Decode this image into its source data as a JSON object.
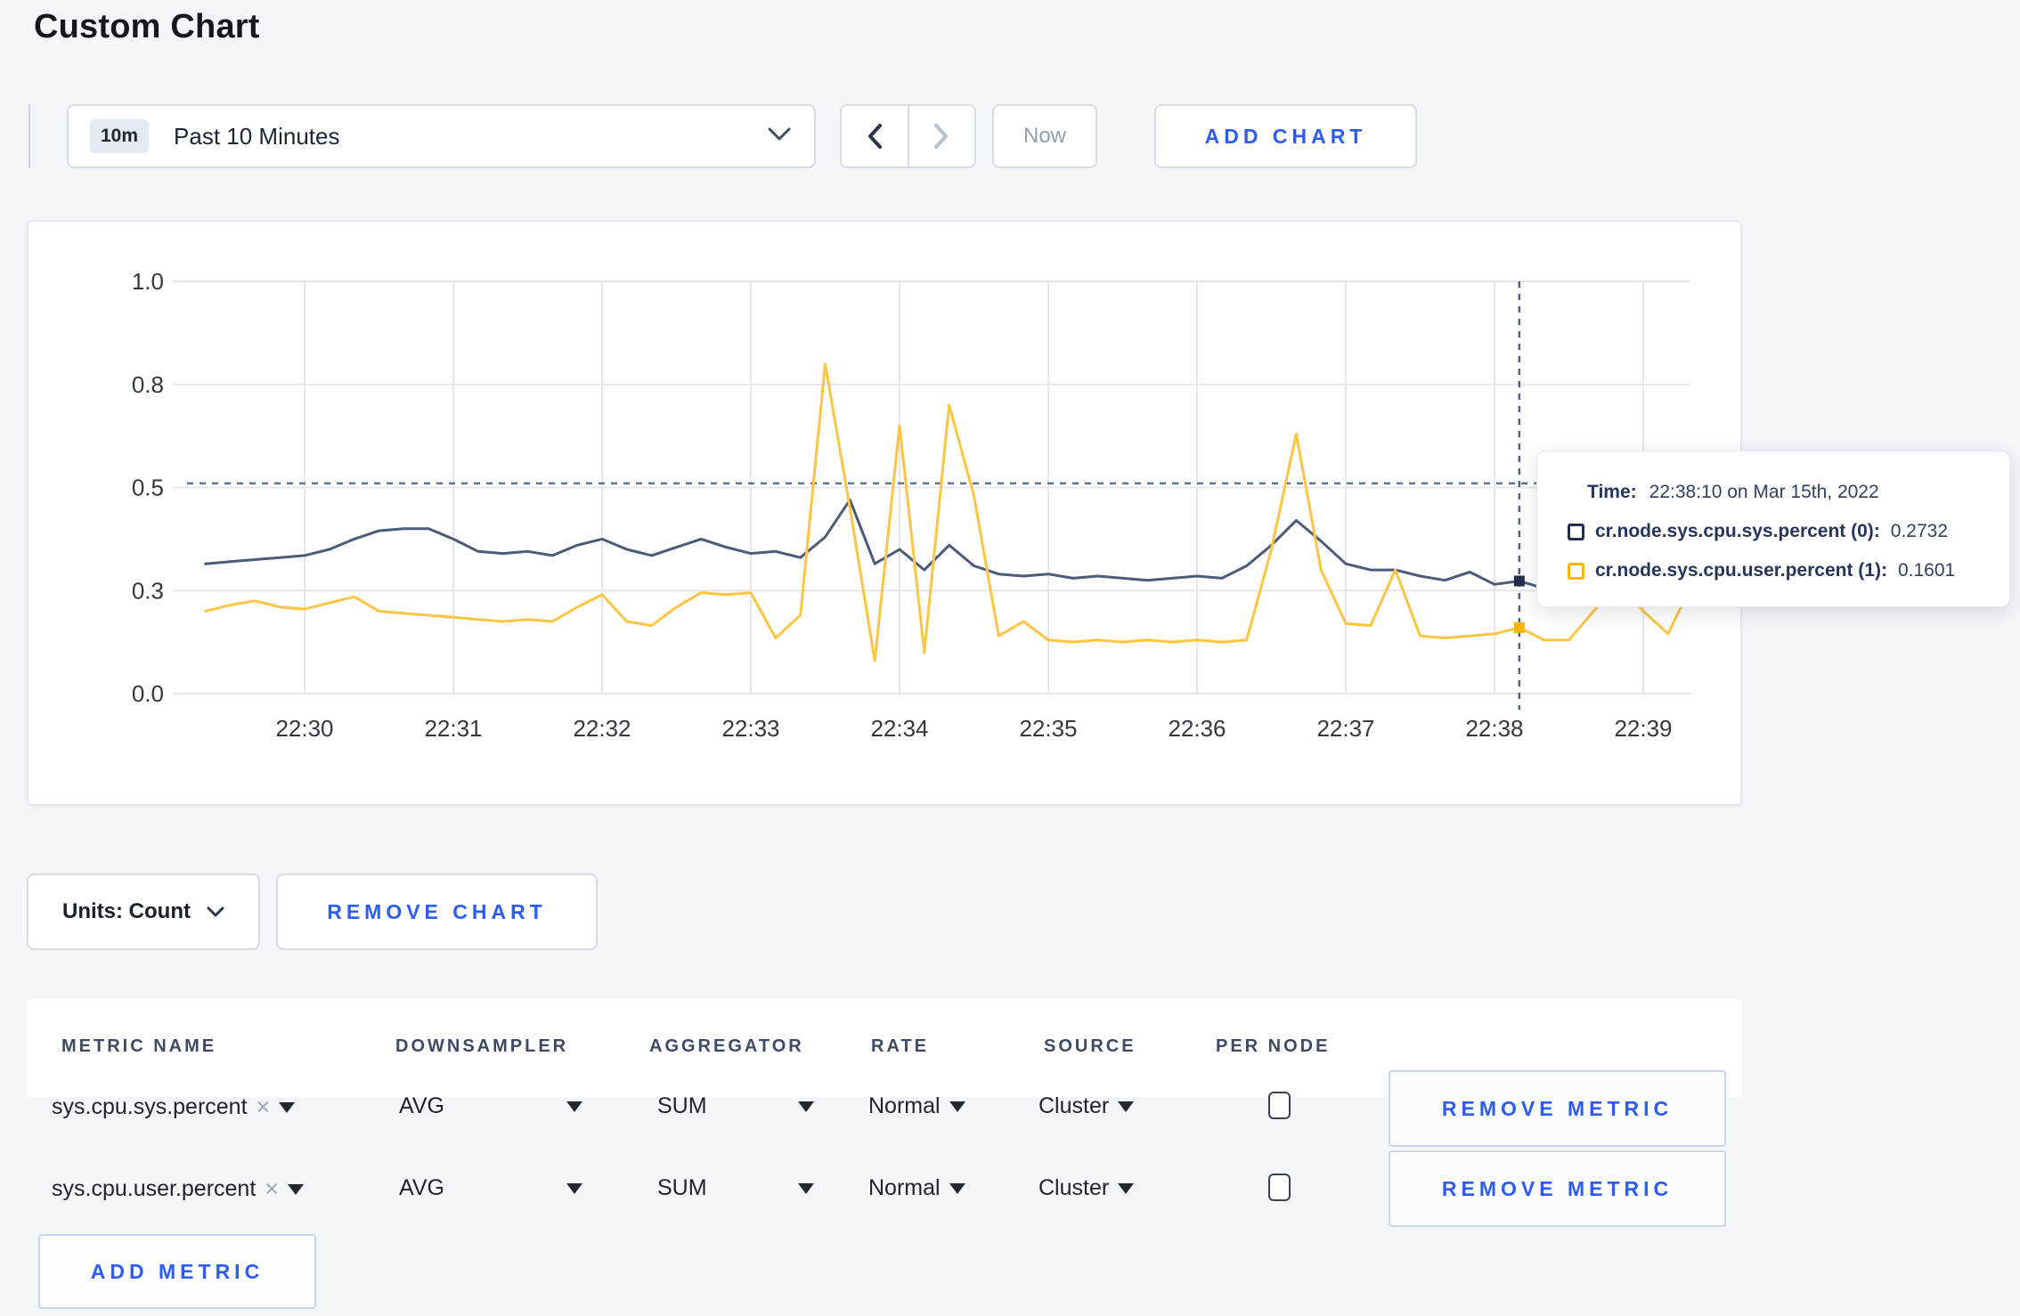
{
  "page": {
    "title": "Custom Chart",
    "background": "#f5f6fa",
    "accent_blue": "#2d5cf2"
  },
  "toolbar": {
    "time_badge": "10m",
    "time_range_label": "Past 10 Minutes",
    "now_label": "Now",
    "add_chart_label": "ADD CHART"
  },
  "tooltip": {
    "time_label": "Time:",
    "time_value": "22:38:10 on Mar 15th, 2022",
    "series": [
      {
        "label": "cr.node.sys.cpu.sys.percent (0):",
        "value": "0.2732",
        "swatch_color": "#232f49"
      },
      {
        "label": "cr.node.sys.cpu.user.percent (1):",
        "value": "0.1601",
        "swatch_color": "#fdb600"
      }
    ]
  },
  "chart_data": {
    "type": "line",
    "title": "",
    "xlabel": "",
    "ylabel": "",
    "ylim": [
      0,
      1
    ],
    "grid": true,
    "y_ticks": [
      {
        "value": 0,
        "label": "0.0"
      },
      {
        "value": 0.25,
        "label": "0.3"
      },
      {
        "value": 0.5,
        "label": "0.5"
      },
      {
        "value": 0.75,
        "label": "0.8"
      },
      {
        "value": 1,
        "label": "1.0"
      }
    ],
    "x_tick_labels": [
      "22:30",
      "22:31",
      "22:32",
      "22:33",
      "22:34",
      "22:35",
      "22:36",
      "22:37",
      "22:38",
      "22:39"
    ],
    "threshold_value": 0.51,
    "start_minute": -0.6667,
    "step_minutes": 0.16667,
    "crosshair": {
      "time": "22:38:10",
      "minute": 8.1667
    },
    "series": [
      {
        "name": "cr.node.sys.cpu.sys.percent",
        "color": "#4c5b77",
        "marker_color": "#232f49",
        "crosshair_value": 0.2732,
        "values": [
          0.315,
          0.32,
          0.325,
          0.33,
          0.335,
          0.35,
          0.375,
          0.395,
          0.4,
          0.4,
          0.375,
          0.345,
          0.34,
          0.345,
          0.335,
          0.36,
          0.375,
          0.35,
          0.335,
          0.355,
          0.375,
          0.355,
          0.34,
          0.345,
          0.33,
          0.38,
          0.47,
          0.315,
          0.35,
          0.3,
          0.36,
          0.31,
          0.29,
          0.285,
          0.29,
          0.28,
          0.285,
          0.28,
          0.275,
          0.28,
          0.285,
          0.28,
          0.31,
          0.36,
          0.42,
          0.37,
          0.315,
          0.3,
          0.3,
          0.285,
          0.275,
          0.295,
          0.265,
          0.2732,
          0.255,
          0.26,
          0.27,
          0.265,
          0.27,
          0.275,
          0.27
        ]
      },
      {
        "name": "cr.node.sys.cpu.user.percent",
        "color": "#fdc543",
        "marker_color": "#fdb600",
        "crosshair_value": 0.1601,
        "values": [
          0.2,
          0.215,
          0.225,
          0.21,
          0.205,
          0.22,
          0.235,
          0.2,
          0.195,
          0.19,
          0.185,
          0.18,
          0.175,
          0.18,
          0.175,
          0.21,
          0.24,
          0.175,
          0.165,
          0.21,
          0.245,
          0.24,
          0.245,
          0.135,
          0.19,
          0.8,
          0.45,
          0.08,
          0.65,
          0.1,
          0.7,
          0.48,
          0.14,
          0.175,
          0.13,
          0.125,
          0.13,
          0.125,
          0.13,
          0.125,
          0.13,
          0.125,
          0.13,
          0.35,
          0.63,
          0.3,
          0.17,
          0.165,
          0.3,
          0.14,
          0.135,
          0.14,
          0.145,
          0.1601,
          0.13,
          0.13,
          0.2,
          0.27,
          0.2,
          0.145,
          0.27
        ]
      }
    ],
    "legend_position": "tooltip"
  },
  "units_row": {
    "units_label": "Units: Count",
    "remove_chart_label": "REMOVE CHART"
  },
  "metrics_table": {
    "headers": [
      "METRIC NAME",
      "DOWNSAMPLER",
      "AGGREGATOR",
      "RATE",
      "SOURCE",
      "PER NODE"
    ],
    "rows": [
      {
        "metric": "sys.cpu.sys.percent",
        "clear": "×",
        "downsampler": "AVG",
        "aggregator": "SUM",
        "rate": "Normal",
        "source": "Cluster",
        "per_node_checked": false,
        "remove_label": "REMOVE METRIC"
      },
      {
        "metric": "sys.cpu.user.percent",
        "clear": "×",
        "downsampler": "AVG",
        "aggregator": "SUM",
        "rate": "Normal",
        "source": "Cluster",
        "per_node_checked": false,
        "remove_label": "REMOVE METRIC"
      }
    ],
    "add_metric_label": "ADD METRIC"
  }
}
